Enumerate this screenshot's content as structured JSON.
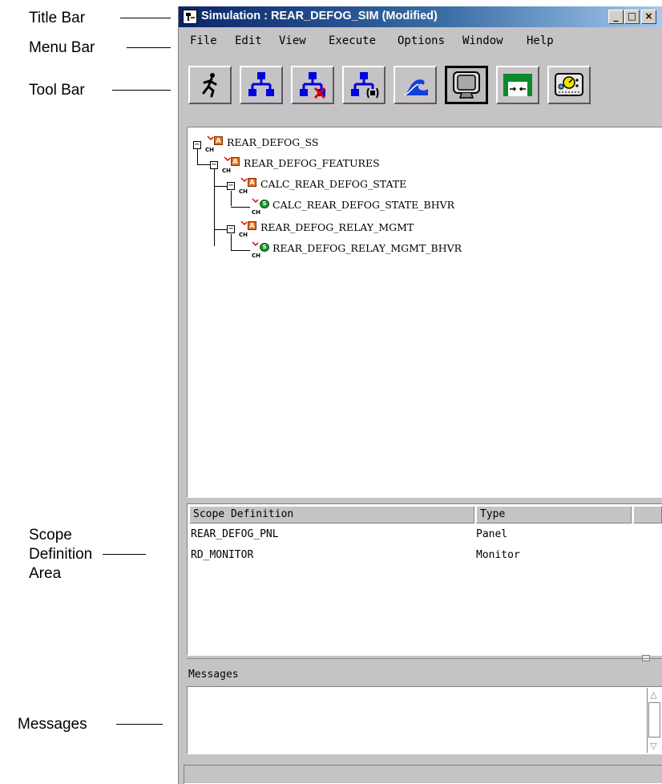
{
  "callouts": {
    "title_bar": "Title Bar",
    "menu_bar": "Menu Bar",
    "tool_bar": "Tool Bar",
    "scope_line1": "Scope",
    "scope_line2": "Definition",
    "scope_line3": "Area",
    "messages": "Messages"
  },
  "window": {
    "title": "Simulation : REAR_DEFOG_SIM (Modified)",
    "controls": {
      "minimize": "_",
      "maximize": "□",
      "close": "×"
    }
  },
  "menu": {
    "file": "File",
    "edit": "Edit",
    "view": "View",
    "execute": "Execute",
    "options": "Options",
    "window": "Window",
    "help": "Help"
  },
  "toolbar": {
    "icons": [
      "run-icon",
      "hierarchy-icon",
      "hierarchy-delete-icon",
      "hierarchy-monitor-icon",
      "wave-icon",
      "monitor-screen-icon",
      "panel-icon",
      "gauge-panel-icon"
    ],
    "active_index": 5
  },
  "tree": {
    "ch": "CH",
    "a": "A",
    "s": "S",
    "nodes": [
      {
        "label": "REAR_DEFOG_SS"
      },
      {
        "label": "REAR_DEFOG_FEATURES"
      },
      {
        "label": "CALC_REAR_DEFOG_STATE"
      },
      {
        "label": "CALC_REAR_DEFOG_STATE_BHVR"
      },
      {
        "label": "REAR_DEFOG_RELAY_MGMT"
      },
      {
        "label": "REAR_DEFOG_RELAY_MGMT_BHVR"
      }
    ]
  },
  "scope": {
    "columns": {
      "definition": "Scope Definition",
      "type": "Type"
    },
    "rows": [
      {
        "definition": "REAR_DEFOG_PNL",
        "type": "Panel"
      },
      {
        "definition": "RD_MONITOR",
        "type": "Monitor"
      }
    ]
  },
  "messages": {
    "label": "Messages",
    "content": ""
  },
  "scroll": {
    "up": "△",
    "down": "▽"
  },
  "colors": {
    "title_gradient_start": "#0a246a",
    "window_bg": "#c6c3c6",
    "tree_a_icon": "#e8741c",
    "tree_s_icon": "#169d2a",
    "toolbar_blue": "#0000e0"
  }
}
